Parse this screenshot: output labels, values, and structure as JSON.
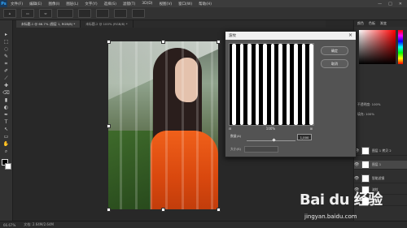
{
  "menu": {
    "logo": "Ps",
    "items": [
      "文件(F)",
      "编辑(E)",
      "图像(I)",
      "图层(L)",
      "文字(Y)",
      "选择(S)",
      "滤镜(T)",
      "3D(D)",
      "视图(V)",
      "窗口(W)",
      "帮助(H)"
    ],
    "window_controls": [
      "—",
      "□",
      "✕"
    ]
  },
  "options": {
    "buttons": [
      "⌂",
      "▭",
      "⇔"
    ]
  },
  "tabs": [
    {
      "label": "未标题-1 @ 66.7% (图层 1, RGB/8) *",
      "active": true
    },
    {
      "label": "未标题-2 @ 100% (RGB/8) *",
      "active": false
    }
  ],
  "tools": [
    "▸",
    "⬚",
    "◌",
    "✎",
    "⌗",
    "✐",
    "⟋",
    "✚",
    "⌫",
    "▮",
    "◐",
    "✒",
    "T",
    "↖",
    "▭",
    "✋",
    "⌕"
  ],
  "dialog": {
    "title": "波纹",
    "ok": "确定",
    "cancel": "取消",
    "zoom_minus": "⊟",
    "zoom_value": "100%",
    "zoom_plus": "⊞",
    "amount_label": "数量(A)",
    "amount_value": "1,000",
    "size_label": "大小(S)"
  },
  "right_panel": {
    "tabs": [
      "颜色",
      "色板",
      "渐变"
    ],
    "opacity_row": "不透明度: 100%",
    "fill_row": "填充: 100%",
    "layers": [
      {
        "name": "图层 1 拷贝 2",
        "selected": false
      },
      {
        "name": "图层 1",
        "selected": true
      },
      {
        "name": "智能滤镜",
        "selected": false
      },
      {
        "name": "波纹",
        "selected": false
      },
      {
        "name": "背景",
        "selected": false
      }
    ]
  },
  "status": {
    "zoom": "66.67%",
    "doc": "文档: 2.64M/2.64M"
  },
  "watermark": {
    "brand": "Bai du 经验",
    "url": "jingyan.baidu.com"
  }
}
